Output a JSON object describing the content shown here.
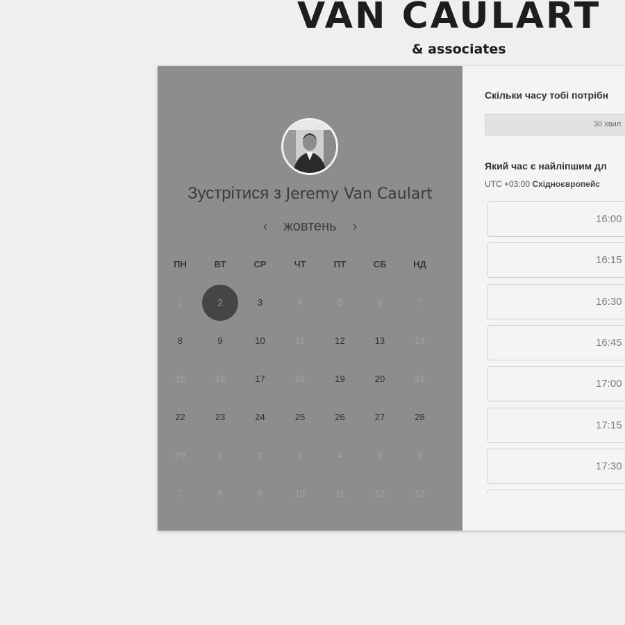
{
  "brand": {
    "title": "VAN CAULART",
    "subtitle": "& associates"
  },
  "scheduler": {
    "meet_prefix": "Зустрітися з ",
    "meet_name": "Jeremy Van Caulart",
    "month": "жовтень",
    "prev_icon": "‹",
    "next_icon": "›",
    "weekdays": [
      "ПН",
      "ВТ",
      "СР",
      "ЧТ",
      "ПТ",
      "СБ",
      "НД"
    ],
    "weeks": [
      [
        {
          "d": "1",
          "s": "dim"
        },
        {
          "d": "2",
          "s": "sel"
        },
        {
          "d": "3",
          "s": "on"
        },
        {
          "d": "4",
          "s": "dim"
        },
        {
          "d": "5",
          "s": "dim"
        },
        {
          "d": "6",
          "s": "dim"
        },
        {
          "d": "7",
          "s": "dim"
        }
      ],
      [
        {
          "d": "8",
          "s": "on"
        },
        {
          "d": "9",
          "s": "on"
        },
        {
          "d": "10",
          "s": "on"
        },
        {
          "d": "11",
          "s": "dim"
        },
        {
          "d": "12",
          "s": "on"
        },
        {
          "d": "13",
          "s": "on"
        },
        {
          "d": "14",
          "s": "dim"
        }
      ],
      [
        {
          "d": "15",
          "s": "dim"
        },
        {
          "d": "16",
          "s": "dim"
        },
        {
          "d": "17",
          "s": "on"
        },
        {
          "d": "18",
          "s": "dim"
        },
        {
          "d": "19",
          "s": "on"
        },
        {
          "d": "20",
          "s": "on"
        },
        {
          "d": "21",
          "s": "dim"
        }
      ],
      [
        {
          "d": "22",
          "s": "on"
        },
        {
          "d": "23",
          "s": "on"
        },
        {
          "d": "24",
          "s": "on"
        },
        {
          "d": "25",
          "s": "on"
        },
        {
          "d": "26",
          "s": "on"
        },
        {
          "d": "27",
          "s": "on"
        },
        {
          "d": "28",
          "s": "on"
        }
      ],
      [
        {
          "d": "29",
          "s": "dim"
        },
        {
          "d": "1",
          "s": "dim"
        },
        {
          "d": "2",
          "s": "dim"
        },
        {
          "d": "3",
          "s": "dim"
        },
        {
          "d": "4",
          "s": "dim"
        },
        {
          "d": "5",
          "s": "dim"
        },
        {
          "d": "6",
          "s": "dim"
        }
      ],
      [
        {
          "d": "7",
          "s": "dim"
        },
        {
          "d": "8",
          "s": "dim"
        },
        {
          "d": "9",
          "s": "dim"
        },
        {
          "d": "10",
          "s": "dim"
        },
        {
          "d": "11",
          "s": "dim"
        },
        {
          "d": "12",
          "s": "dim"
        },
        {
          "d": "13",
          "s": "dim"
        }
      ]
    ]
  },
  "booking": {
    "duration_label": "Скільки часу тобі потрібн",
    "duration_value": "30 хвил",
    "time_label": "Який час є найліпшим дл",
    "tz_offset": "UTC +03:00",
    "tz_name": "Східноєвропейс",
    "slots": [
      "16:00",
      "16:15",
      "16:30",
      "16:45",
      "17:00",
      "17:15",
      "17:30",
      ""
    ]
  },
  "colors": {
    "page_bg": "#efefef",
    "left_panel": "#8d8d8d",
    "right_panel": "#f4f4f4",
    "selected_day": "#454545"
  }
}
